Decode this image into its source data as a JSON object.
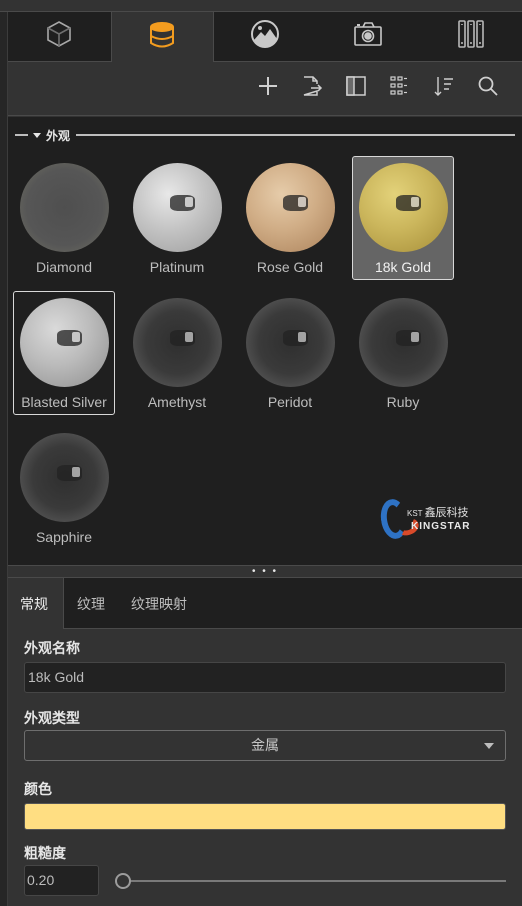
{
  "top_tabs": [
    {
      "name": "model",
      "icon": "cube-icon",
      "active": false
    },
    {
      "name": "appearance",
      "icon": "paint-bucket-icon",
      "active": true
    },
    {
      "name": "environment",
      "icon": "image-icon",
      "active": false
    },
    {
      "name": "camera",
      "icon": "camera-icon",
      "active": false
    },
    {
      "name": "library",
      "icon": "books-icon",
      "active": false
    }
  ],
  "toolbar": [
    {
      "name": "add",
      "icon": "plus-icon"
    },
    {
      "name": "export",
      "icon": "export-file-icon"
    },
    {
      "name": "split-view",
      "icon": "panel-split-icon"
    },
    {
      "name": "list-view",
      "icon": "list-grid-icon"
    },
    {
      "name": "sort",
      "icon": "sort-icon"
    },
    {
      "name": "search",
      "icon": "search-icon"
    }
  ],
  "library": {
    "section_title": "外观",
    "materials": [
      {
        "label": "Diamond",
        "style": "diamond",
        "state": ""
      },
      {
        "label": "Platinum",
        "style": "platinum",
        "state": ""
      },
      {
        "label": "Rose Gold",
        "style": "rose",
        "state": ""
      },
      {
        "label": "18k Gold",
        "style": "gold",
        "state": "selected"
      },
      {
        "label": "Blasted Silver",
        "style": "blasted",
        "state": "hover"
      },
      {
        "label": "Amethyst",
        "style": "gem",
        "state": ""
      },
      {
        "label": "Peridot",
        "style": "gem",
        "state": ""
      },
      {
        "label": "Ruby",
        "style": "gem",
        "state": ""
      },
      {
        "label": "Sapphire",
        "style": "gem",
        "state": ""
      }
    ],
    "logo": {
      "kst": "KST",
      "cn": "鑫辰科技",
      "en": "KINGSTAR"
    }
  },
  "splitter": "• • •",
  "prop_tabs": [
    {
      "label": "常规",
      "active": true
    },
    {
      "label": "纹理",
      "active": false
    },
    {
      "label": "纹理映射",
      "active": false
    }
  ],
  "props": {
    "name_label": "外观名称",
    "name_value": "18k Gold",
    "type_label": "外观类型",
    "type_value": "金属",
    "color_label": "颜色",
    "color_value": "#FFDE82",
    "roughness_label": "粗糙度",
    "roughness_value": "0.20",
    "roughness_fraction": 0.0
  },
  "colors": {
    "accent": "#F39C1F",
    "panel_bg": "#333333",
    "dark_bg": "#1F1F1F"
  }
}
